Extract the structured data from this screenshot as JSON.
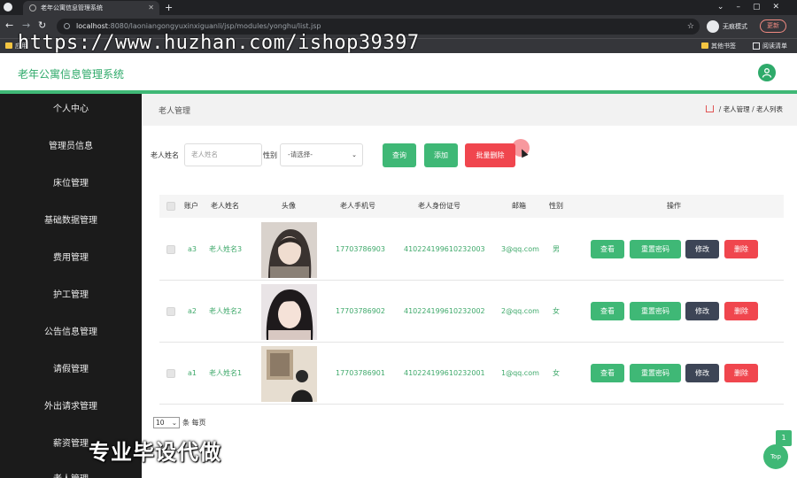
{
  "browser": {
    "tab_title": "老年公寓信息管理系统",
    "url_host": "localhost",
    "url_rest": ":8080/laoniangongyuxinxiguanli/jsp/modules/yonghu/list.jsp",
    "incognito_label": "无痕模式",
    "update_label": "更新",
    "bookmarks": [
      "应用",
      "其他书签",
      "阅读清单"
    ]
  },
  "watermarks": {
    "top": "https://www.huzhan.com/ishop39397",
    "bottom": "专业毕设代做"
  },
  "app": {
    "title": "老年公寓信息管理系统"
  },
  "sidebar": {
    "items": [
      {
        "label": "个人中心"
      },
      {
        "label": "管理员信息"
      },
      {
        "label": "床位管理"
      },
      {
        "label": "基础数据管理"
      },
      {
        "label": "费用管理"
      },
      {
        "label": "护工管理"
      },
      {
        "label": "公告信息管理"
      },
      {
        "label": "请假管理"
      },
      {
        "label": "外出请求管理"
      },
      {
        "label": "薪资管理"
      },
      {
        "label": "老人管理"
      }
    ]
  },
  "page": {
    "title": "老人管理",
    "breadcrumb": [
      "老人管理",
      "老人列表"
    ]
  },
  "filters": {
    "name_label": "老人姓名",
    "name_placeholder": "老人姓名",
    "gender_label": "性别",
    "gender_selected": "-请选择-",
    "search_button": "查询",
    "add_button": "添加",
    "batch_delete_button": "批量删除"
  },
  "table": {
    "headers": [
      "账户",
      "老人姓名",
      "头像",
      "老人手机号",
      "老人身份证号",
      "邮箱",
      "性别",
      "操作"
    ],
    "rows": [
      {
        "account": "a3",
        "name": "老人姓名3",
        "phone": "17703786903",
        "id_card": "410224199610232003",
        "email": "3@qq.com",
        "gender": "男"
      },
      {
        "account": "a2",
        "name": "老人姓名2",
        "phone": "17703786902",
        "id_card": "410224199610232002",
        "email": "2@qq.com",
        "gender": "女"
      },
      {
        "account": "a1",
        "name": "老人姓名1",
        "phone": "17703786901",
        "id_card": "410224199610232001",
        "email": "1@qq.com",
        "gender": "女"
      }
    ],
    "actions": {
      "view": "查看",
      "reset": "重置密码",
      "edit": "修改",
      "delete": "删除"
    }
  },
  "pager": {
    "page_size": "10",
    "per_page_label": "条 每页"
  },
  "floating": {
    "page_number": "1",
    "top_label": "Top"
  },
  "colors": {
    "accent": "#3fb876",
    "danger": "#f0464e",
    "dark": "#3d4556",
    "sidebar_bg": "#1b1b1b"
  }
}
